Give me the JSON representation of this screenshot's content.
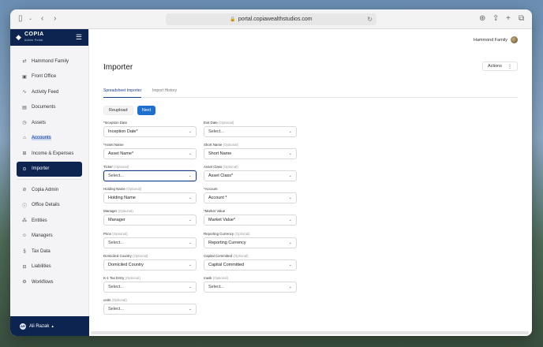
{
  "browser": {
    "url": "portal.copiawealthstudios.com"
  },
  "brand": {
    "name": "COPIA",
    "subtitle": "Admin Portal"
  },
  "sidebar": {
    "items": [
      {
        "label": "Hammond Family",
        "icon": "arrows-swap-icon"
      },
      {
        "label": "Front Office",
        "icon": "briefcase-icon"
      },
      {
        "label": "Activity Feed",
        "icon": "activity-icon"
      },
      {
        "label": "Documents",
        "icon": "document-icon"
      },
      {
        "label": "Assets",
        "icon": "clock-icon"
      },
      {
        "label": "Accounts",
        "icon": "bank-icon"
      },
      {
        "label": "Income & Expenses",
        "icon": "income-icon"
      },
      {
        "label": "Importer",
        "icon": "import-icon"
      }
    ],
    "admin_items": [
      {
        "label": "Copia Admin",
        "icon": "check-circle-icon"
      },
      {
        "label": "Office Details",
        "icon": "info-icon"
      },
      {
        "label": "Entities",
        "icon": "entities-icon"
      },
      {
        "label": "Managers",
        "icon": "users-icon"
      },
      {
        "label": "Tax Data",
        "icon": "tax-icon"
      },
      {
        "label": "Liabilities",
        "icon": "liabilities-icon"
      },
      {
        "label": "Workflows",
        "icon": "workflow-icon"
      }
    ],
    "user": {
      "initials": "AR",
      "name": "Ali Razak"
    }
  },
  "header": {
    "family": "Hammond Family",
    "page_title": "Importer",
    "actions_label": "Actions"
  },
  "tabs": [
    {
      "label": "Spreadsheet Importer",
      "active": true
    },
    {
      "label": "Import History",
      "active": false
    }
  ],
  "buttons": {
    "reupload": "Reupload",
    "next": "Next"
  },
  "optional_text": "(Optional)",
  "fields": [
    {
      "label": "*Inception Date",
      "optional": false,
      "value": "Inception Date*",
      "placeholder": false
    },
    {
      "label": "Exit Date",
      "optional": true,
      "value": "Select...",
      "placeholder": true
    },
    {
      "label": "*Asset Name",
      "optional": false,
      "value": "Asset Name*",
      "placeholder": false
    },
    {
      "label": "Short Name",
      "optional": true,
      "value": "Short Name",
      "placeholder": false
    },
    {
      "label": "Ticker",
      "optional": true,
      "value": "Select...",
      "placeholder": true,
      "focused": true
    },
    {
      "label": "Asset Class",
      "optional": true,
      "value": "Asset Class*",
      "placeholder": false
    },
    {
      "label": "Holding Name",
      "optional": true,
      "value": "Holding Name",
      "placeholder": false
    },
    {
      "label": "*Account",
      "optional": false,
      "value": "Account *",
      "placeholder": false
    },
    {
      "label": "Manager",
      "optional": true,
      "value": "Manager",
      "placeholder": false
    },
    {
      "label": "*Market Value",
      "optional": false,
      "value": "Market Value*",
      "placeholder": false
    },
    {
      "label": "Price",
      "optional": true,
      "value": "Select...",
      "placeholder": true
    },
    {
      "label": "Reporting Currency",
      "optional": true,
      "value": "Reporting Currency",
      "placeholder": false
    },
    {
      "label": "Domiciled Country",
      "optional": true,
      "value": "Domiciled Country",
      "placeholder": false
    },
    {
      "label": "Capital Committed",
      "optional": true,
      "value": "Capital Committed",
      "placeholder": false
    },
    {
      "label": "K-1 Tax Entry",
      "optional": true,
      "value": "Select...",
      "placeholder": true
    },
    {
      "label": "mask",
      "optional": true,
      "value": "Select...",
      "placeholder": true
    },
    {
      "label": "units",
      "optional": true,
      "value": "Select...",
      "placeholder": true
    }
  ],
  "colors": {
    "navy": "#0d2451",
    "primary": "#1f6fd1",
    "accent_text": "#1b3d8f"
  }
}
